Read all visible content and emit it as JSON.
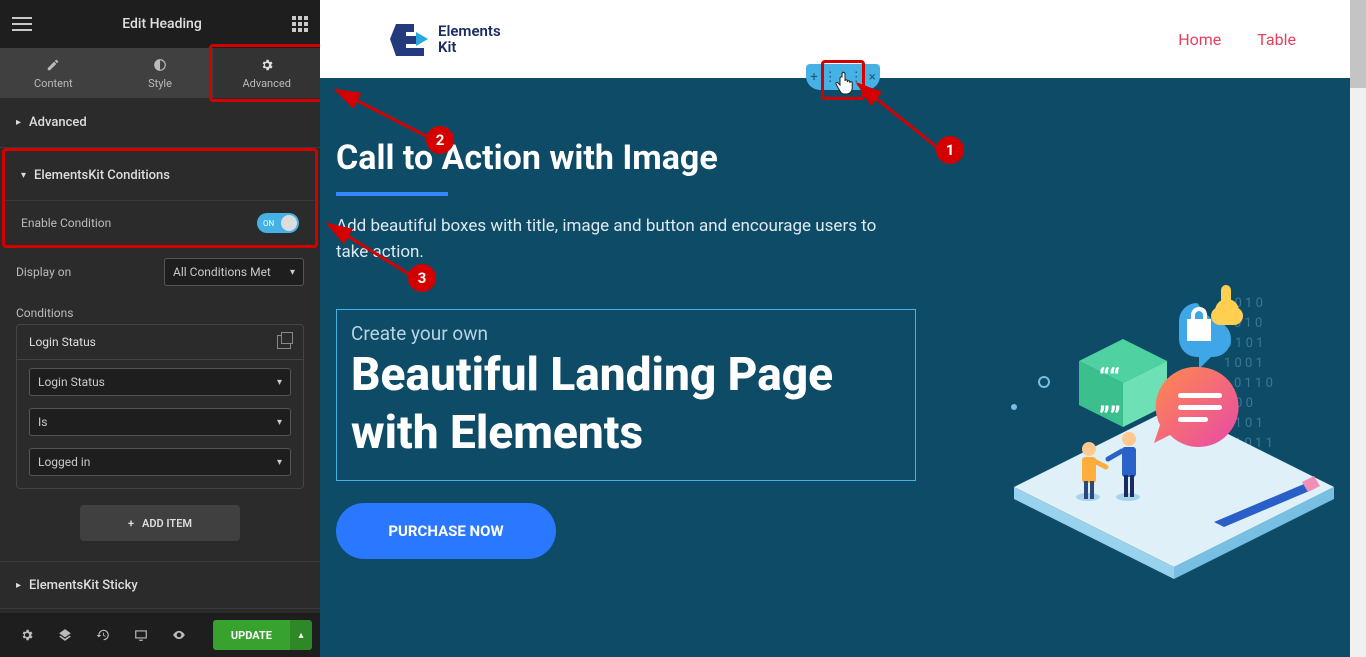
{
  "sidebar": {
    "title": "Edit Heading",
    "tabs": {
      "content": "Content",
      "style": "Style",
      "advanced": "Advanced"
    },
    "sections": {
      "advanced_header": "Advanced",
      "conditions_header": "ElementsKit Conditions",
      "sticky_header": "ElementsKit Sticky"
    },
    "cond": {
      "enable_label": "Enable Condition",
      "toggle_state": "ON",
      "display_on_label": "Display on",
      "display_on_value": "All Conditions Met",
      "conditions_label": "Conditions",
      "item_title": "Login Status",
      "item_field_1": "Login Status",
      "item_field_2": "Is",
      "item_field_3": "Logged in",
      "add_label": "ADD ITEM"
    },
    "footer": {
      "update": "UPDATE"
    }
  },
  "nav": {
    "home": "Home",
    "table": "Table"
  },
  "logo": {
    "line1": "Elements",
    "line2": "Kit"
  },
  "hero": {
    "heading": "Call to Action with Image",
    "desc": "Add beautiful boxes with title, image and button and encourage users to take action.",
    "small": "Create your own",
    "h1_line1": "Beautiful Landing Page",
    "h1_line2": "with Elements",
    "cta": "PURCHASE NOW"
  },
  "ann": {
    "n1": "1",
    "n2": "2",
    "n3": "3"
  }
}
